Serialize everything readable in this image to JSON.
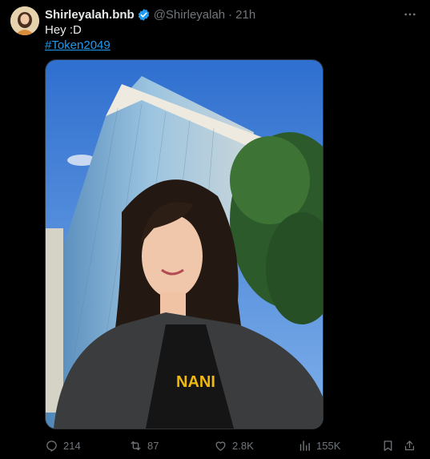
{
  "author": {
    "display_name": "Shirleyalah.bnb",
    "handle": "@Shirleyalah",
    "separator": "·",
    "time": "21h"
  },
  "post": {
    "text": "Hey :D",
    "hashtag": "#Token2049"
  },
  "media": {
    "overlay_text": "NANI"
  },
  "actions": {
    "replies": "214",
    "reposts": "87",
    "likes": "2.8K",
    "views": "155K"
  },
  "icons": {
    "verified": "verified-badge-icon",
    "more": "more-horizontal-icon",
    "reply": "reply-icon",
    "repost": "repost-icon",
    "like": "heart-icon",
    "views": "views-bar-chart-icon",
    "bookmark": "bookmark-icon",
    "share": "share-icon"
  },
  "colors": {
    "background": "#000000",
    "text": "#e7e9ea",
    "secondary": "#71767b",
    "link": "#1d9bf0"
  }
}
